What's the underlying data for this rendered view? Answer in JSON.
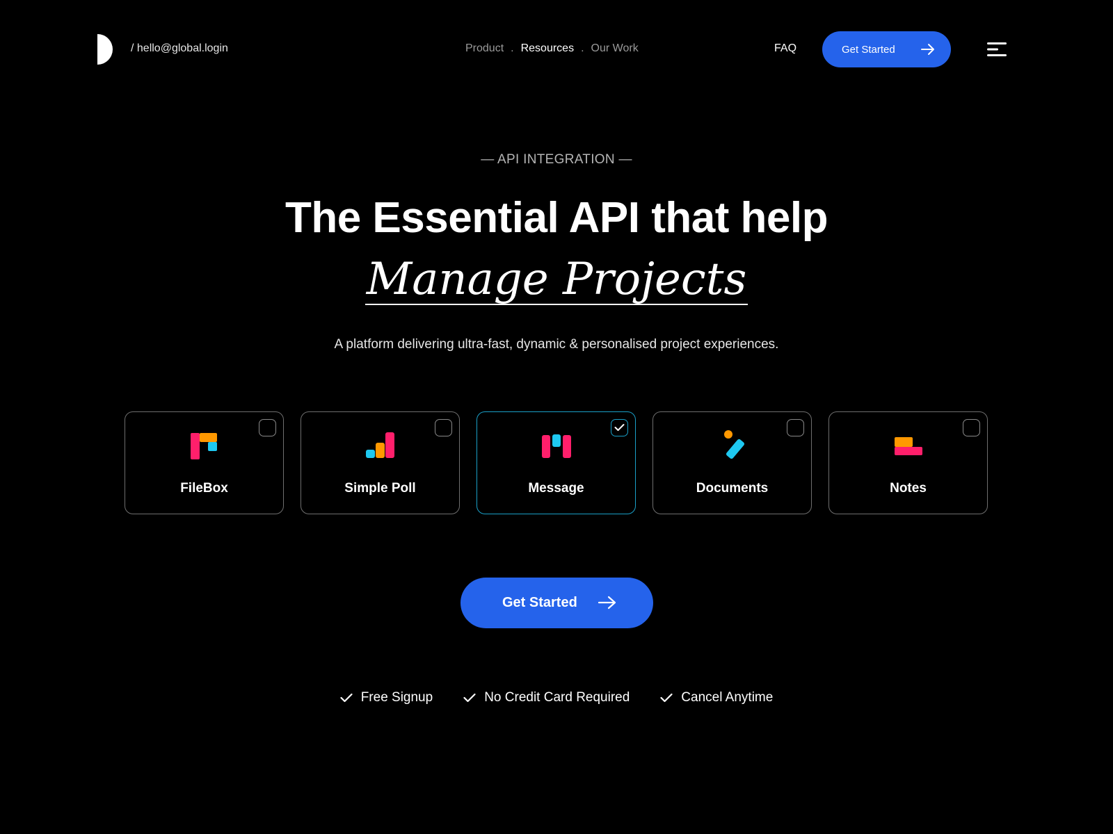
{
  "header": {
    "email": "/ hello@global.login",
    "nav": [
      {
        "label": "Product",
        "active": false
      },
      {
        "label": "Resources",
        "active": true
      },
      {
        "label": "Our Work",
        "active": false
      }
    ],
    "separator": ".",
    "faq": "FAQ",
    "cta_label": "Get Started",
    "logo_icon": "half-circle-logo-icon",
    "menu_icon": "hamburger-menu-icon",
    "arrow_icon": "arrow-right-icon"
  },
  "hero": {
    "eyebrow": "— API INTEGRATION —",
    "title": "The Essential API that help",
    "title_italic": "Manage Projects",
    "subtitle": "A platform delivering ultra-fast, dynamic & personalised project experiences."
  },
  "cards": [
    {
      "label": "FileBox",
      "icon": "filebox-icon",
      "selected": false
    },
    {
      "label": "Simple Poll",
      "icon": "simple-poll-icon",
      "selected": false
    },
    {
      "label": "Message",
      "icon": "message-icon",
      "selected": true
    },
    {
      "label": "Documents",
      "icon": "documents-icon",
      "selected": false
    },
    {
      "label": "Notes",
      "icon": "notes-icon",
      "selected": false
    }
  ],
  "cta": {
    "label": "Get Started"
  },
  "perks": [
    "Free Signup",
    "No Credit Card Required",
    "Cancel Anytime"
  ],
  "colors": {
    "background": "#000000",
    "accent_blue": "#2563eb",
    "selected_border": "#1aa0c8",
    "pink": "#ff1f6b",
    "orange": "#ff9800",
    "cyan": "#1ec8f0"
  }
}
